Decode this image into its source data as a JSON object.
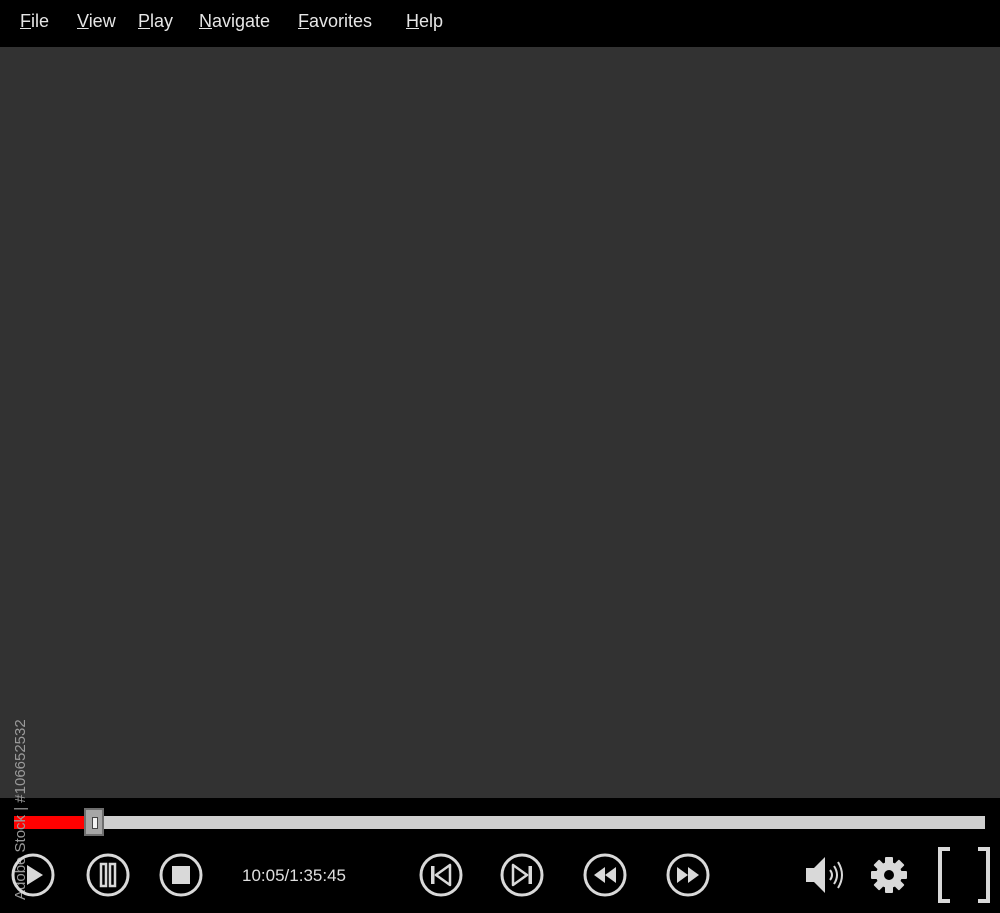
{
  "menu": [
    {
      "accel": "F",
      "rest": "ile"
    },
    {
      "accel": "V",
      "rest": "iew"
    },
    {
      "accel": "P",
      "rest": "lay"
    },
    {
      "accel": "N",
      "rest": "avigate"
    },
    {
      "accel": "F",
      "rest": "avorites"
    },
    {
      "accel": "H",
      "rest": "elp"
    }
  ],
  "player": {
    "time": "10:05/1:35:45",
    "progress_fraction": 0.082
  },
  "watermark": {
    "text": "Adobe Stock | #106652532"
  },
  "colors": {
    "progress": "#ff0000",
    "track": "#cfcfcf",
    "video_bg": "#323232",
    "icon": "#d9d9d9"
  },
  "icons": {
    "play": "play-icon",
    "pause": "pause-icon",
    "stop": "stop-icon",
    "prev": "skip-previous-icon",
    "next": "skip-next-icon",
    "rewind": "rewind-icon",
    "forward": "fast-forward-icon",
    "volume": "volume-icon",
    "settings": "gear-icon",
    "fullscreen": "fullscreen-icon"
  }
}
